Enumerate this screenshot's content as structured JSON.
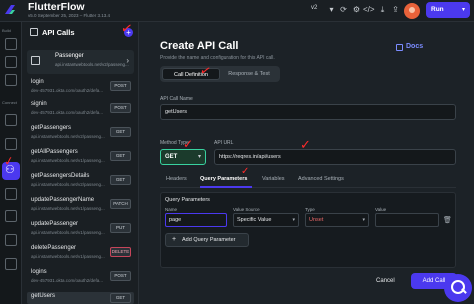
{
  "app": {
    "brand": "FlutterFlow",
    "version": "v5.0 September 25, 2023 – Flutter 3.13.4"
  },
  "topbar": {
    "version_select": "v2",
    "run_label": "Run"
  },
  "rail": {
    "labels": [
      "Build",
      "Connect"
    ]
  },
  "panel": {
    "title": "API Calls",
    "group": {
      "name": "Passenger",
      "url": "api.instantwebtools.net/v2/passeng..."
    },
    "items": [
      {
        "name": "login",
        "url": "dev-457931.okta.com/oauth2/defa...",
        "method": "POST"
      },
      {
        "name": "signin",
        "url": "dev-457931.okta.com/oauth2/defa...",
        "method": "POST"
      },
      {
        "name": "getPassengers",
        "url": "api.instantwebtools.net/v2/passeng...",
        "method": "GET"
      },
      {
        "name": "getAllPassengers",
        "url": "api.instantwebtools.net/v1/passeng...",
        "method": "GET"
      },
      {
        "name": "getPassengersDetails",
        "url": "api.instantwebtools.net/v2/passeng...",
        "method": "GET"
      },
      {
        "name": "updatePassengerName",
        "url": "api.instantwebtools.net/v1/passeng...",
        "method": "PATCH"
      },
      {
        "name": "updatePassenger",
        "url": "api.instantwebtools.net/v1/passeng...",
        "method": "PUT"
      },
      {
        "name": "deletePassenger",
        "url": "api.instantwebtools.net/v1/passeng...",
        "method": "DELETE"
      },
      {
        "name": "logins",
        "url": "dev-457931.okta.com/oauth2/defa...",
        "method": "POST"
      },
      {
        "name": "getUsers",
        "url": "",
        "method": "GET"
      }
    ]
  },
  "dialog": {
    "title": "Create API Call",
    "subtitle": "Provide the name and configuration for this API call.",
    "docs_label": "Docs",
    "segments": [
      "Call Definition",
      "Response & Test"
    ],
    "name_label": "API Call Name",
    "name_value": "getUsers",
    "method_label": "Method Type",
    "method_value": "GET",
    "url_label": "API URL",
    "url_value": "https://reqres.in/api/users",
    "tabs": [
      "Headers",
      "Query Parameters",
      "Variables",
      "Advanced Settings"
    ],
    "query": {
      "title": "Query Parameters",
      "columns": [
        "Name",
        "Value Source",
        "Type",
        "Value"
      ],
      "row": {
        "name": "page",
        "source": "Specific Value",
        "type": "Unset",
        "value": ""
      },
      "add_label": "Add Query Parameter"
    },
    "cancel_label": "Cancel",
    "add_label": "Add Call"
  },
  "colors": {
    "accent": "#4b39ef",
    "get": "#39d2a0",
    "annotation": "#ff2a2a"
  }
}
